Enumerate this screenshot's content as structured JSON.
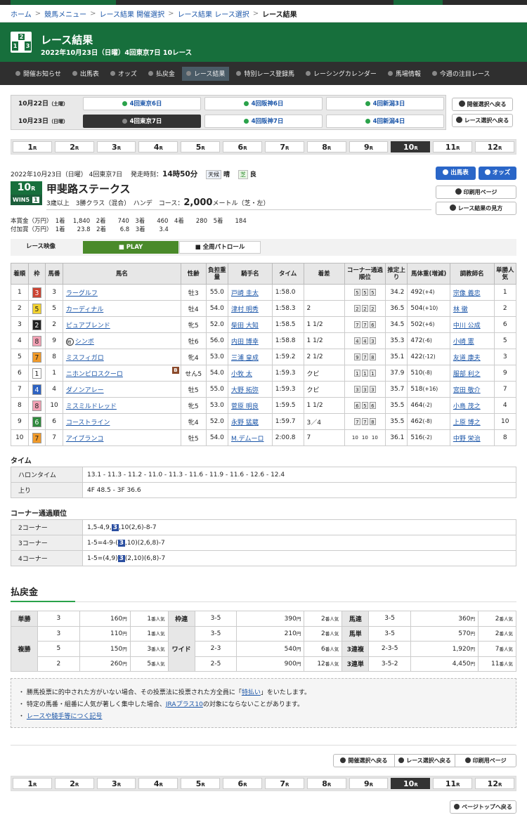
{
  "breadcrumb": [
    "ホーム",
    "競馬メニュー",
    "レース結果 開催選択",
    "レース結果 レース選択"
  ],
  "breadcrumb_current": "レース結果",
  "header": {
    "logo_digits": [
      "2",
      "1",
      "3"
    ],
    "title": "レース結果",
    "subtitle": "2022年10月23日（日曜）4回東京7日 10レース"
  },
  "nav": [
    "開催お知らせ",
    "出馬表",
    "オッズ",
    "払戻金",
    "レース結果",
    "特別レース登録馬",
    "レーシングカレンダー",
    "馬場情報",
    "今週の注目レース"
  ],
  "days": [
    {
      "date": "10月22日",
      "dow": "（土曜）",
      "meets": [
        "4回東京6日",
        "4回阪神6日",
        "4回新潟3日"
      ]
    },
    {
      "date": "10月23日",
      "dow": "（日曜）",
      "meets": [
        "4回東京7日",
        "4回阪神7日",
        "4回新潟4日"
      ]
    }
  ],
  "right_buttons": [
    "開催選択へ戻る",
    "レース選択へ戻る"
  ],
  "race_numbers": [
    "1",
    "2",
    "3",
    "4",
    "5",
    "6",
    "7",
    "8",
    "9",
    "10",
    "11",
    "12"
  ],
  "race_unit": "R",
  "race": {
    "date_place": "2022年10月23日（日曜） 4回東京7日",
    "start_label": "発走時刻：",
    "start_time": "14時50分",
    "weather_label": "天候",
    "weather": "晴",
    "track_label": "芝",
    "track": "良",
    "num": "10",
    "num_unit": "R",
    "win5": "WIN5",
    "win5_no": "1",
    "name": "甲斐路ステークス",
    "cond": "3歳以上　3勝クラス（混合）　ハンデ",
    "course_label": "コース：",
    "course_dist": "2,000",
    "course_unit": "メートル（芝・左）",
    "prize1": "本賞金（万円）　1着　 1,840　2着　　740　3着　　460　4着　　280　5着　　184",
    "prize2": "付加賞（万円）　1着　　23.8　2着　　 6.8　3着　　 3.4",
    "btn_shutsuba": "出馬表",
    "btn_odds": "オッズ",
    "btn_print": "印刷用ページ",
    "btn_howto": "レース結果の見方"
  },
  "video": {
    "label": "レース映像",
    "play": "PLAY",
    "patrol": "全周パトロール"
  },
  "result_headers": [
    "着順",
    "枠",
    "馬番",
    "馬名",
    "性齢",
    "負担重量",
    "騎手名",
    "タイム",
    "着差",
    "コーナー通過順位",
    "推定上り",
    "馬体重(増減)",
    "調教師名",
    "単勝人気"
  ],
  "results": [
    {
      "pos": "1",
      "waku": "3",
      "num": "3",
      "horse": "ラーグルフ",
      "mark": "",
      "sa": "牡3",
      "wt": "55.0",
      "jockey": "戸崎 圭太",
      "time": "1:58.0",
      "margin": "",
      "corner": [
        "5",
        "5",
        "5"
      ],
      "agari": "34.2",
      "bw": "492",
      "bwd": "(+4)",
      "trainer": "宗像 義忠",
      "pop": "1",
      "blinker": ""
    },
    {
      "pos": "2",
      "waku": "5",
      "num": "5",
      "horse": "カーディナル",
      "mark": "",
      "sa": "牡4",
      "wt": "54.0",
      "jockey": "津村 明秀",
      "time": "1:58.3",
      "margin": "2",
      "corner": [
        "2",
        "2",
        "2"
      ],
      "agari": "36.5",
      "bw": "504",
      "bwd": "(+10)",
      "trainer": "林 徹",
      "pop": "2",
      "blinker": ""
    },
    {
      "pos": "3",
      "waku": "2",
      "num": "2",
      "horse": "ピュアブレンド",
      "mark": "",
      "sa": "牝5",
      "wt": "52.0",
      "jockey": "柴田 大知",
      "time": "1:58.5",
      "margin": "1 1/2",
      "corner": [
        "7",
        "7",
        "6"
      ],
      "agari": "34.5",
      "bw": "502",
      "bwd": "(+6)",
      "trainer": "中川 公成",
      "pop": "6",
      "blinker": ""
    },
    {
      "pos": "4",
      "waku": "8",
      "num": "9",
      "horse": "シンボ",
      "mark": "地",
      "sa": "牡6",
      "wt": "56.0",
      "jockey": "内田 博幸",
      "time": "1:58.8",
      "margin": "1 1/2",
      "corner": [
        "4",
        "4",
        "3"
      ],
      "agari": "35.3",
      "bw": "472",
      "bwd": "(-6)",
      "trainer": "小崎 憲",
      "pop": "5",
      "blinker": ""
    },
    {
      "pos": "5",
      "waku": "7",
      "num": "8",
      "horse": "ミスフィガロ",
      "mark": "",
      "sa": "牝4",
      "wt": "53.0",
      "jockey": "三浦 皇成",
      "time": "1:59.2",
      "margin": "2 1/2",
      "corner": [
        "9",
        "7",
        "8"
      ],
      "agari": "35.1",
      "bw": "422",
      "bwd": "(-12)",
      "trainer": "友道 康夫",
      "pop": "3",
      "blinker": ""
    },
    {
      "pos": "6",
      "waku": "1",
      "num": "1",
      "horse": "ニホンピロスクーロ",
      "mark": "",
      "sa": "せん5",
      "wt": "54.0",
      "jockey": "小牧 太",
      "time": "1:59.3",
      "margin": "クビ",
      "corner": [
        "1",
        "1",
        "1"
      ],
      "agari": "37.9",
      "bw": "510",
      "bwd": "(-8)",
      "trainer": "服部 利之",
      "pop": "9",
      "blinker": "B"
    },
    {
      "pos": "7",
      "waku": "4",
      "num": "4",
      "horse": "ダノンアレー",
      "mark": "",
      "sa": "牡5",
      "wt": "55.0",
      "jockey": "大野 拓弥",
      "time": "1:59.3",
      "margin": "クビ",
      "corner": [
        "3",
        "3",
        "3"
      ],
      "agari": "35.7",
      "bw": "518",
      "bwd": "(+16)",
      "trainer": "宮田 敬介",
      "pop": "7",
      "blinker": ""
    },
    {
      "pos": "8",
      "waku": "8",
      "num": "10",
      "horse": "ミスミルドレッド",
      "mark": "",
      "sa": "牝5",
      "wt": "53.0",
      "jockey": "菅原 明良",
      "time": "1:59.5",
      "margin": "1 1/2",
      "corner": [
        "6",
        "5",
        "6"
      ],
      "agari": "35.5",
      "bw": "464",
      "bwd": "(-2)",
      "trainer": "小島 茂之",
      "pop": "4",
      "blinker": ""
    },
    {
      "pos": "9",
      "waku": "6",
      "num": "6",
      "horse": "コーストライン",
      "mark": "",
      "sa": "牝4",
      "wt": "52.0",
      "jockey": "永野 猛蔵",
      "time": "1:59.7",
      "margin": "3／4",
      "corner": [
        "7",
        "7",
        "8"
      ],
      "agari": "35.5",
      "bw": "462",
      "bwd": "(-8)",
      "trainer": "上原 博之",
      "pop": "10",
      "blinker": ""
    },
    {
      "pos": "10",
      "waku": "7",
      "num": "7",
      "horse": "アイブランコ",
      "mark": "",
      "sa": "牡5",
      "wt": "54.0",
      "jockey": "M.デムーロ",
      "time": "2:00.8",
      "margin": "7",
      "corner": [
        "10",
        "10",
        "10"
      ],
      "agari": "36.1",
      "bw": "516",
      "bwd": "(-2)",
      "trainer": "中野 栄治",
      "pop": "8",
      "blinker": ""
    }
  ],
  "time_section": {
    "title": "タイム",
    "rows": [
      {
        "k": "ハロンタイム",
        "v": "13.1 - 11.3 - 11.2 - 11.0 - 11.3 - 11.6 - 11.9 - 11.6 - 12.6 - 12.4"
      },
      {
        "k": "上り",
        "v": "4F 48.5 - 3F 36.6"
      }
    ]
  },
  "corner_section": {
    "title": "コーナー通過順位",
    "rows": [
      {
        "k": "2コーナー",
        "pre": "1,5-4,9,",
        "hl": "3",
        "post": ",10(2,6)-8-7"
      },
      {
        "k": "3コーナー",
        "pre": "1-5=4-9-(",
        "hl": "3",
        "post": ",10)(2,6,8)-7"
      },
      {
        "k": "4コーナー",
        "pre": "1-5=(4,9)",
        "hl": "3",
        "post": "(2,10)(6,8)-7"
      }
    ]
  },
  "payout": {
    "title": "払戻金",
    "yen": "円",
    "ninki": "番人気",
    "tansho": {
      "label": "単勝",
      "rows": [
        {
          "n": "3",
          "p": "160",
          "pop": "1"
        }
      ]
    },
    "fukusho": {
      "label": "複勝",
      "rows": [
        {
          "n": "3",
          "p": "110",
          "pop": "1"
        },
        {
          "n": "5",
          "p": "150",
          "pop": "3"
        },
        {
          "n": "2",
          "p": "260",
          "pop": "5"
        }
      ]
    },
    "wakuren": {
      "label": "枠連",
      "rows": [
        {
          "n": "3-5",
          "p": "390",
          "pop": "2"
        }
      ]
    },
    "wide": {
      "label": "ワイド",
      "rows": [
        {
          "n": "3-5",
          "p": "210",
          "pop": "2"
        },
        {
          "n": "2-3",
          "p": "540",
          "pop": "6"
        },
        {
          "n": "2-5",
          "p": "900",
          "pop": "12"
        }
      ]
    },
    "umaren": {
      "label": "馬連",
      "rows": [
        {
          "n": "3-5",
          "p": "360",
          "pop": "2"
        }
      ]
    },
    "umatan": {
      "label": "馬単",
      "rows": [
        {
          "n": "3-5",
          "p": "570",
          "pop": "2"
        }
      ]
    },
    "sanrenpuku": {
      "label": "3連複",
      "rows": [
        {
          "n": "2-3-5",
          "p": "1,920",
          "pop": "7"
        }
      ]
    },
    "sanrentan": {
      "label": "3連単",
      "rows": [
        {
          "n": "3-5-2",
          "p": "4,450",
          "pop": "11"
        }
      ]
    }
  },
  "notes": {
    "n1a": "勝馬投票に的中された方がいない場合、その投票法に投票された方全員に「",
    "n1link": "特払い",
    "n1b": "」をいたします。",
    "n2a": "特定の馬番・組番に人気が著しく集中した場合、",
    "n2link": "JRAプラス10",
    "n2b": "の対象にならないことがあります。",
    "n3link": "レースや騎手等につく記号"
  },
  "footer": {
    "btns": [
      "開催選択へ戻る",
      "レース選択へ戻る",
      "印刷用ページ"
    ],
    "top": "ページトップへ戻る"
  }
}
